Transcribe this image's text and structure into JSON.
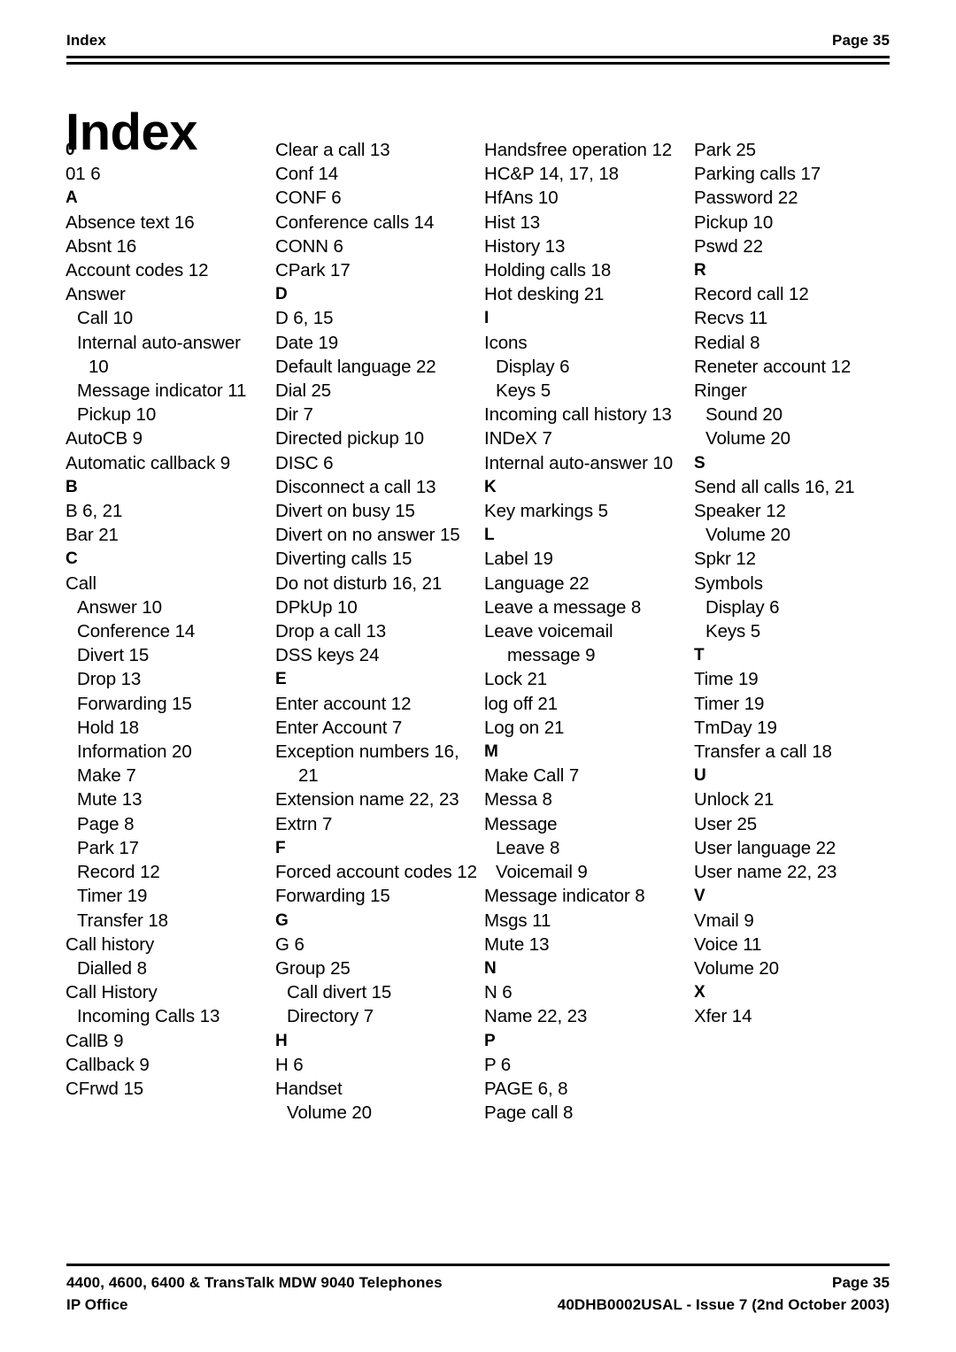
{
  "header": {
    "title": "Index",
    "page_label": "Page 35"
  },
  "page_title": "Index",
  "columns": [
    {
      "name": "column-1",
      "entries": [
        {
          "text": "0",
          "level": "letter"
        },
        {
          "text": "01 6",
          "level": 0
        },
        {
          "text": "A",
          "level": "letter"
        },
        {
          "text": "Absence text 16",
          "level": 0
        },
        {
          "text": "Absnt 16",
          "level": 0
        },
        {
          "text": "Account codes 12",
          "level": 0
        },
        {
          "text": "Answer",
          "level": 0
        },
        {
          "text": "Call 10",
          "level": 1
        },
        {
          "text": "Internal auto-answer",
          "level": 1
        },
        {
          "text": "10",
          "level": "cont"
        },
        {
          "text": "Message indicator 11",
          "level": 1
        },
        {
          "text": "Pickup 10",
          "level": 1
        },
        {
          "text": "AutoCB 9",
          "level": 0
        },
        {
          "text": "Automatic callback 9",
          "level": 0
        },
        {
          "text": "B",
          "level": "letter"
        },
        {
          "text": "B 6, 21",
          "level": 0
        },
        {
          "text": "Bar 21",
          "level": 0
        },
        {
          "text": "C",
          "level": "letter"
        },
        {
          "text": "Call",
          "level": 0
        },
        {
          "text": "Answer 10",
          "level": 1
        },
        {
          "text": "Conference 14",
          "level": 1
        },
        {
          "text": "Divert 15",
          "level": 1
        },
        {
          "text": "Drop 13",
          "level": 1
        },
        {
          "text": "Forwarding 15",
          "level": 1
        },
        {
          "text": "Hold 18",
          "level": 1
        },
        {
          "text": "Information 20",
          "level": 1
        },
        {
          "text": "Make 7",
          "level": 1
        },
        {
          "text": "Mute 13",
          "level": 1
        },
        {
          "text": "Page 8",
          "level": 1
        },
        {
          "text": "Park 17",
          "level": 1
        },
        {
          "text": "Record 12",
          "level": 1
        },
        {
          "text": "Timer 19",
          "level": 1
        },
        {
          "text": "Transfer 18",
          "level": 1
        },
        {
          "text": "Call history",
          "level": 0
        },
        {
          "text": "Dialled 8",
          "level": 1
        },
        {
          "text": "Call History",
          "level": 0
        },
        {
          "text": "Incoming Calls 13",
          "level": 1
        },
        {
          "text": "CallB 9",
          "level": 0
        },
        {
          "text": "Callback 9",
          "level": 0
        },
        {
          "text": "CFrwd 15",
          "level": 0
        }
      ]
    },
    {
      "name": "column-2",
      "entries": [
        {
          "text": "Clear a call 13",
          "level": 0
        },
        {
          "text": "Conf 14",
          "level": 0
        },
        {
          "text": "CONF 6",
          "level": 0
        },
        {
          "text": "Conference calls 14",
          "level": 0
        },
        {
          "text": "CONN 6",
          "level": 0
        },
        {
          "text": "CPark 17",
          "level": 0
        },
        {
          "text": "D",
          "level": "letter"
        },
        {
          "text": "D 6, 15",
          "level": 0
        },
        {
          "text": "Date 19",
          "level": 0
        },
        {
          "text": "Default language 22",
          "level": 0
        },
        {
          "text": "Dial 25",
          "level": 0
        },
        {
          "text": "Dir 7",
          "level": 0
        },
        {
          "text": "Directed pickup 10",
          "level": 0
        },
        {
          "text": "DISC 6",
          "level": 0
        },
        {
          "text": "Disconnect a call 13",
          "level": 0
        },
        {
          "text": "Divert on busy 15",
          "level": 0
        },
        {
          "text": "Divert on no answer 15",
          "level": 0
        },
        {
          "text": "Diverting calls 15",
          "level": 0
        },
        {
          "text": "Do not disturb 16, 21",
          "level": 0
        },
        {
          "text": "DPkUp 10",
          "level": 0
        },
        {
          "text": "Drop a call 13",
          "level": 0
        },
        {
          "text": "DSS keys 24",
          "level": 0
        },
        {
          "text": "E",
          "level": "letter"
        },
        {
          "text": "Enter account 12",
          "level": 0
        },
        {
          "text": "Enter Account 7",
          "level": 0
        },
        {
          "text": "Exception numbers 16,",
          "level": 0
        },
        {
          "text": "21",
          "level": "cont"
        },
        {
          "text": "Extension name 22, 23",
          "level": 0
        },
        {
          "text": "Extrn 7",
          "level": 0
        },
        {
          "text": "F",
          "level": "letter"
        },
        {
          "text": "Forced account codes 12",
          "level": 0
        },
        {
          "text": "Forwarding 15",
          "level": 0
        },
        {
          "text": "G",
          "level": "letter"
        },
        {
          "text": "G 6",
          "level": 0
        },
        {
          "text": "Group 25",
          "level": 0
        },
        {
          "text": "Call divert 15",
          "level": 1
        },
        {
          "text": "Directory 7",
          "level": 1
        },
        {
          "text": "H",
          "level": "letter"
        },
        {
          "text": "H 6",
          "level": 0
        },
        {
          "text": "Handset",
          "level": 0
        },
        {
          "text": "Volume 20",
          "level": 1
        }
      ]
    },
    {
      "name": "column-3",
      "entries": [
        {
          "text": "Handsfree operation 12",
          "level": 0
        },
        {
          "text": "HC&P 14, 17, 18",
          "level": 0
        },
        {
          "text": "HfAns 10",
          "level": 0
        },
        {
          "text": "Hist 13",
          "level": 0
        },
        {
          "text": "History 13",
          "level": 0
        },
        {
          "text": "Holding calls 18",
          "level": 0
        },
        {
          "text": "Hot desking 21",
          "level": 0
        },
        {
          "text": "I",
          "level": "letter"
        },
        {
          "text": "Icons",
          "level": 0
        },
        {
          "text": "Display 6",
          "level": 1
        },
        {
          "text": "Keys 5",
          "level": 1
        },
        {
          "text": "Incoming call history 13",
          "level": 0
        },
        {
          "text": "INDeX 7",
          "level": 0
        },
        {
          "text": "Internal auto-answer 10",
          "level": 0
        },
        {
          "text": "K",
          "level": "letter"
        },
        {
          "text": "Key markings 5",
          "level": 0
        },
        {
          "text": "L",
          "level": "letter"
        },
        {
          "text": "Label 19",
          "level": 0
        },
        {
          "text": "Language 22",
          "level": 0
        },
        {
          "text": "Leave a message 8",
          "level": 0
        },
        {
          "text": "Leave voicemail",
          "level": 0
        },
        {
          "text": "message 9",
          "level": "cont"
        },
        {
          "text": "Lock 21",
          "level": 0
        },
        {
          "text": "log off 21",
          "level": 0
        },
        {
          "text": "Log on 21",
          "level": 0
        },
        {
          "text": "M",
          "level": "letter"
        },
        {
          "text": "Make Call 7",
          "level": 0
        },
        {
          "text": "Messa 8",
          "level": 0
        },
        {
          "text": "Message",
          "level": 0
        },
        {
          "text": "Leave 8",
          "level": 1
        },
        {
          "text": "Voicemail 9",
          "level": 1
        },
        {
          "text": "Message indicator 8",
          "level": 0
        },
        {
          "text": "Msgs 11",
          "level": 0
        },
        {
          "text": "Mute 13",
          "level": 0
        },
        {
          "text": "N",
          "level": "letter"
        },
        {
          "text": "N 6",
          "level": 0
        },
        {
          "text": "Name 22, 23",
          "level": 0
        },
        {
          "text": "P",
          "level": "letter"
        },
        {
          "text": "P 6",
          "level": 0
        },
        {
          "text": "PAGE 6, 8",
          "level": 0
        },
        {
          "text": "Page call 8",
          "level": 0
        }
      ]
    },
    {
      "name": "column-4",
      "entries": [
        {
          "text": "Park 25",
          "level": 0
        },
        {
          "text": "Parking calls 17",
          "level": 0
        },
        {
          "text": "Password 22",
          "level": 0
        },
        {
          "text": "Pickup 10",
          "level": 0
        },
        {
          "text": "Pswd 22",
          "level": 0
        },
        {
          "text": "R",
          "level": "letter"
        },
        {
          "text": "Record call 12",
          "level": 0
        },
        {
          "text": "Recvs 11",
          "level": 0
        },
        {
          "text": "Redial 8",
          "level": 0
        },
        {
          "text": "Reneter account 12",
          "level": 0
        },
        {
          "text": "Ringer",
          "level": 0
        },
        {
          "text": "Sound 20",
          "level": 1
        },
        {
          "text": "Volume 20",
          "level": 1
        },
        {
          "text": "S",
          "level": "letter"
        },
        {
          "text": "Send all calls 16, 21",
          "level": 0
        },
        {
          "text": "Speaker 12",
          "level": 0
        },
        {
          "text": "Volume 20",
          "level": 1
        },
        {
          "text": "Spkr 12",
          "level": 0
        },
        {
          "text": "Symbols",
          "level": 0
        },
        {
          "text": "Display 6",
          "level": 1
        },
        {
          "text": "Keys 5",
          "level": 1
        },
        {
          "text": "T",
          "level": "letter"
        },
        {
          "text": "Time 19",
          "level": 0
        },
        {
          "text": "Timer 19",
          "level": 0
        },
        {
          "text": "TmDay 19",
          "level": 0
        },
        {
          "text": "Transfer a call 18",
          "level": 0
        },
        {
          "text": "U",
          "level": "letter"
        },
        {
          "text": "Unlock 21",
          "level": 0
        },
        {
          "text": "User 25",
          "level": 0
        },
        {
          "text": "User language 22",
          "level": 0
        },
        {
          "text": "User name 22, 23",
          "level": 0
        },
        {
          "text": "V",
          "level": "letter"
        },
        {
          "text": "Vmail 9",
          "level": 0
        },
        {
          "text": "Voice 11",
          "level": 0
        },
        {
          "text": "Volume 20",
          "level": 0
        },
        {
          "text": "X",
          "level": "letter"
        },
        {
          "text": "Xfer 14",
          "level": 0
        }
      ]
    }
  ],
  "footer": {
    "line1_left": "4400, 4600, 6400 & TransTalk MDW 9040 Telephones",
    "line1_right": "Page 35",
    "line2_left": "IP Office",
    "line2_right": "40DHB0002USAL - Issue 7 (2nd October 2003)"
  }
}
